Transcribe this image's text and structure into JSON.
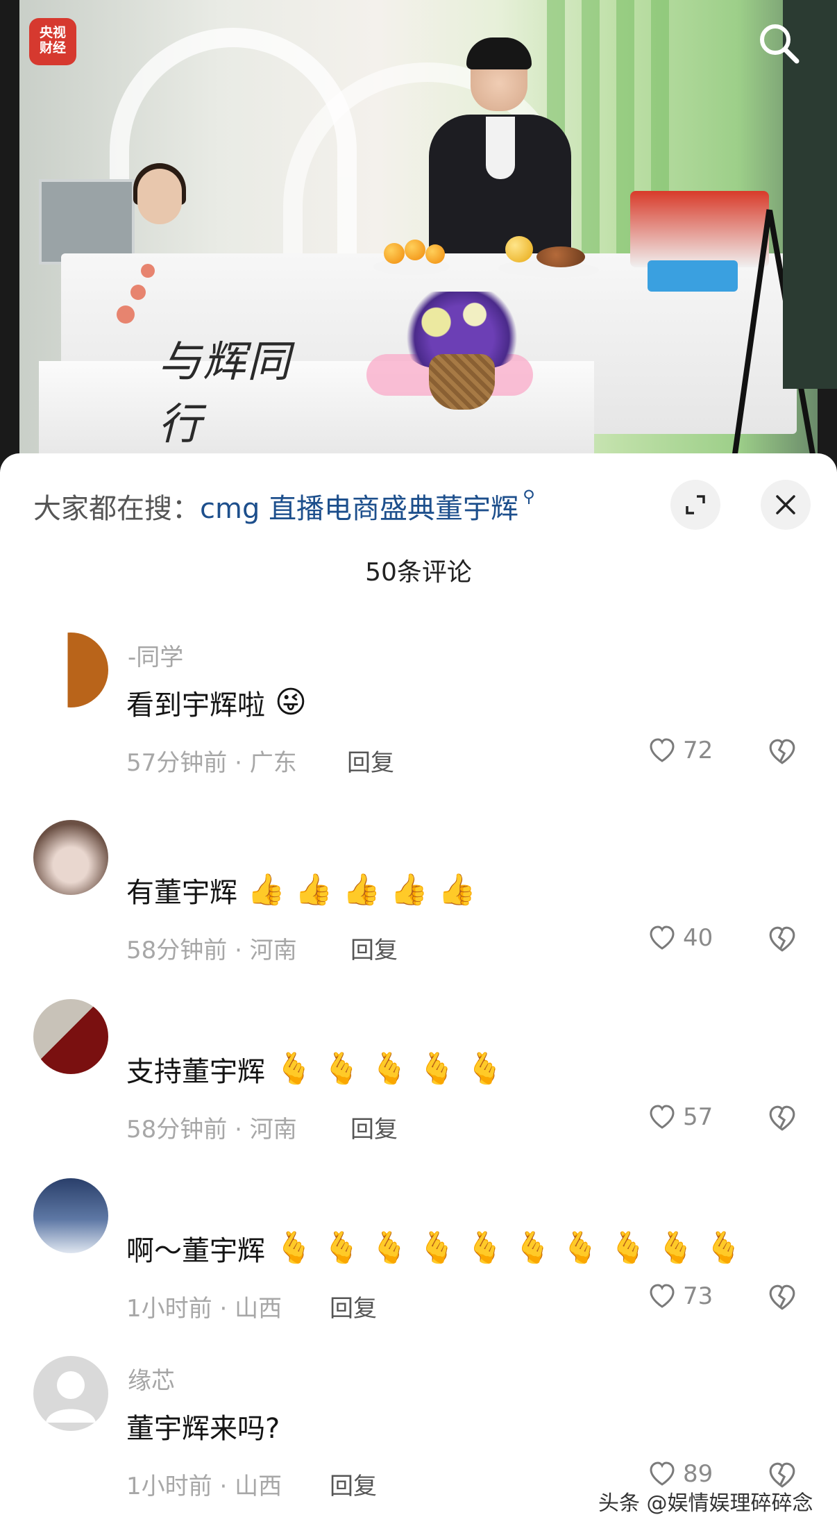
{
  "video": {
    "channel_logo_line1": "央视",
    "channel_logo_line2": "财经",
    "desk_sign": "与辉同行"
  },
  "search": {
    "prefix": "大家都在搜：",
    "query": "cmg 直播电商盛典董宇辉"
  },
  "comments_title": "50条评论",
  "comments": [
    {
      "username": "-同学",
      "text": "看到宇辉啦",
      "emoji": "😜",
      "emoji_count": 1,
      "time": "57分钟前",
      "region": "广东",
      "reply": "回复",
      "likes": "72"
    },
    {
      "username": "",
      "text": "有董宇辉",
      "emoji": "👍",
      "emoji_count": 5,
      "time": "58分钟前",
      "region": "河南",
      "reply": "回复",
      "likes": "40"
    },
    {
      "username": "",
      "text": "支持董宇辉",
      "emoji": "🫰",
      "emoji_count": 5,
      "time": "58分钟前",
      "region": "河南",
      "reply": "回复",
      "likes": "57"
    },
    {
      "username": "",
      "text": "啊～董宇辉",
      "emoji": "🫰",
      "emoji_count": 10,
      "time": "1小时前",
      "region": "山西",
      "reply": "回复",
      "likes": "73"
    },
    {
      "username": "缘芯",
      "text": "董宇辉来吗?",
      "emoji": "",
      "emoji_count": 0,
      "time": "1小时前",
      "region": "山西",
      "reply": "回复",
      "likes": "89"
    }
  ],
  "watermark": "头条 @娱情娱理碎碎念",
  "colors": {
    "link": "#1d4f8c",
    "meta": "#a7a7a7",
    "text": "#141414"
  },
  "icons": [
    "search-icon",
    "expand-icon",
    "close-icon",
    "heart-icon",
    "broken-heart-icon"
  ]
}
